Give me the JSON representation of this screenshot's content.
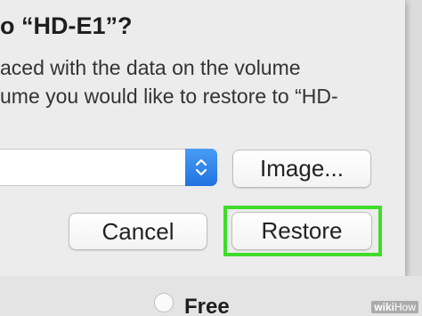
{
  "dialog": {
    "title": "o “HD-E1”?",
    "description_line1": "aced with the data on the volume",
    "description_line2": "ume you would like to restore to “HD-"
  },
  "source_select": {
    "selected_value": "",
    "stepper_icon": "up-down-chevron-icon"
  },
  "buttons": {
    "image_label": "Image...",
    "cancel_label": "Cancel",
    "restore_label": "Restore"
  },
  "background": {
    "free_label": "Free"
  },
  "watermark": {
    "wiki": "wiki",
    "how": "How"
  },
  "colors": {
    "highlight": "#3fdc2c",
    "accent_blue": "#1f73e0"
  }
}
